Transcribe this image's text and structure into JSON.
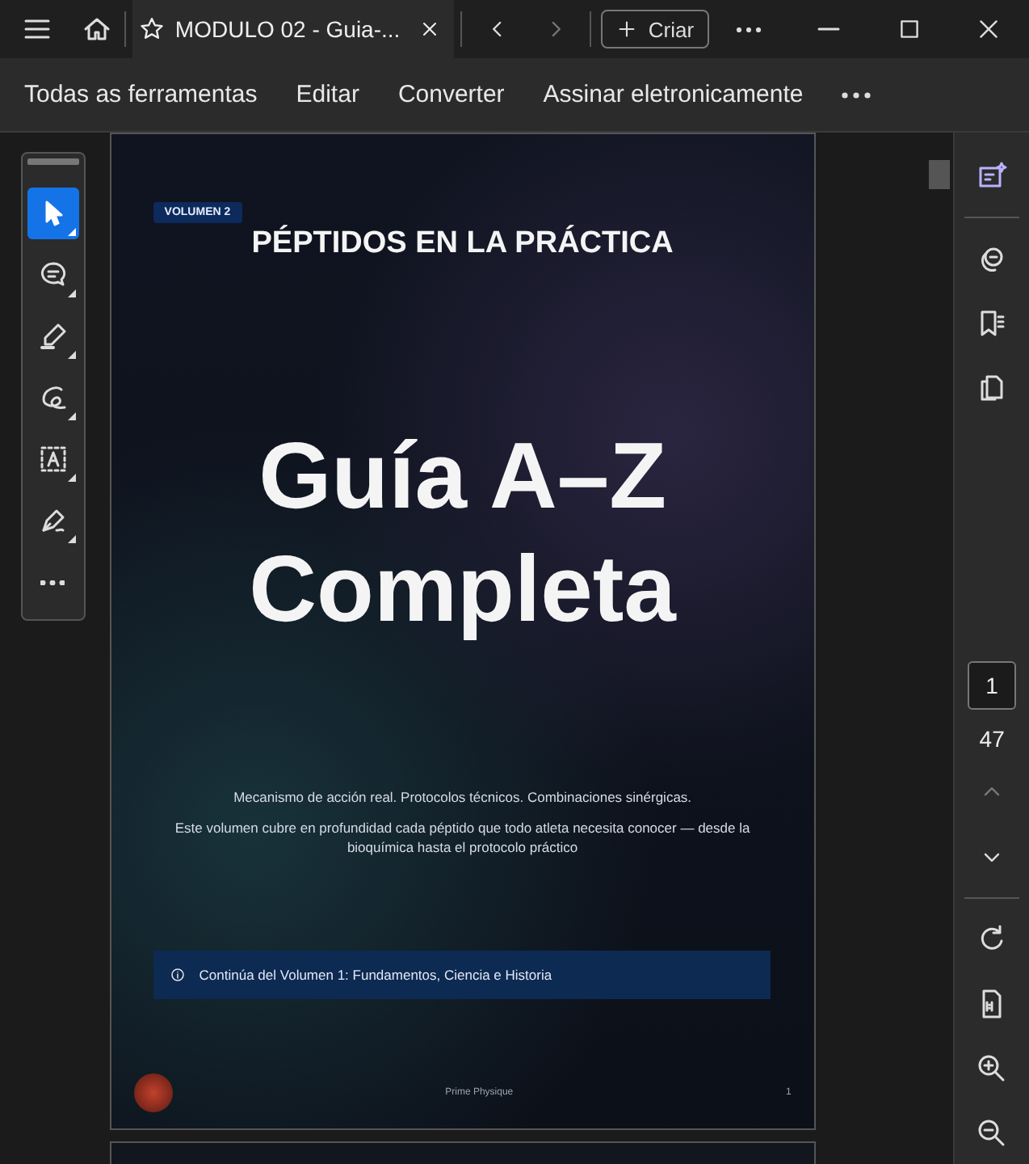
{
  "title_bar": {
    "tab": {
      "title": "MODULO 02 - Guia-...",
      "selected": true
    },
    "new_button": "Criar"
  },
  "menu": [
    {
      "label": "Todas as ferramentas"
    },
    {
      "label": "Editar"
    },
    {
      "label": "Converter"
    },
    {
      "label": "Assinar eletronicamente"
    }
  ],
  "tools": [
    {
      "kind": "select",
      "selected": true
    },
    {
      "kind": "comment",
      "selected": false
    },
    {
      "kind": "highlight",
      "selected": false
    },
    {
      "kind": "draw",
      "selected": false
    },
    {
      "kind": "text",
      "selected": false
    },
    {
      "kind": "sign",
      "selected": false
    },
    {
      "kind": "more",
      "selected": false
    }
  ],
  "page": {
    "badge": "VOLUMEN 2",
    "heading": "PÉPTIDOS EN LA PRÁCTICA",
    "title_lines": [
      "Guía A–Z",
      "Completa"
    ],
    "tagline": "Mecanismo de acción real. Protocolos técnicos. Combinaciones sinérgicas.",
    "description": "Este volumen cubre en profundidad cada péptido que todo atleta necesita conocer — desde la bioquímica hasta el protocolo práctico",
    "notice": "Continúa del Volumen 1: Fundamentos, Ciencia e Historia",
    "footer_text": "Prime Physique",
    "page_number": "1"
  },
  "page_nav": {
    "current": "1",
    "total": "47"
  }
}
